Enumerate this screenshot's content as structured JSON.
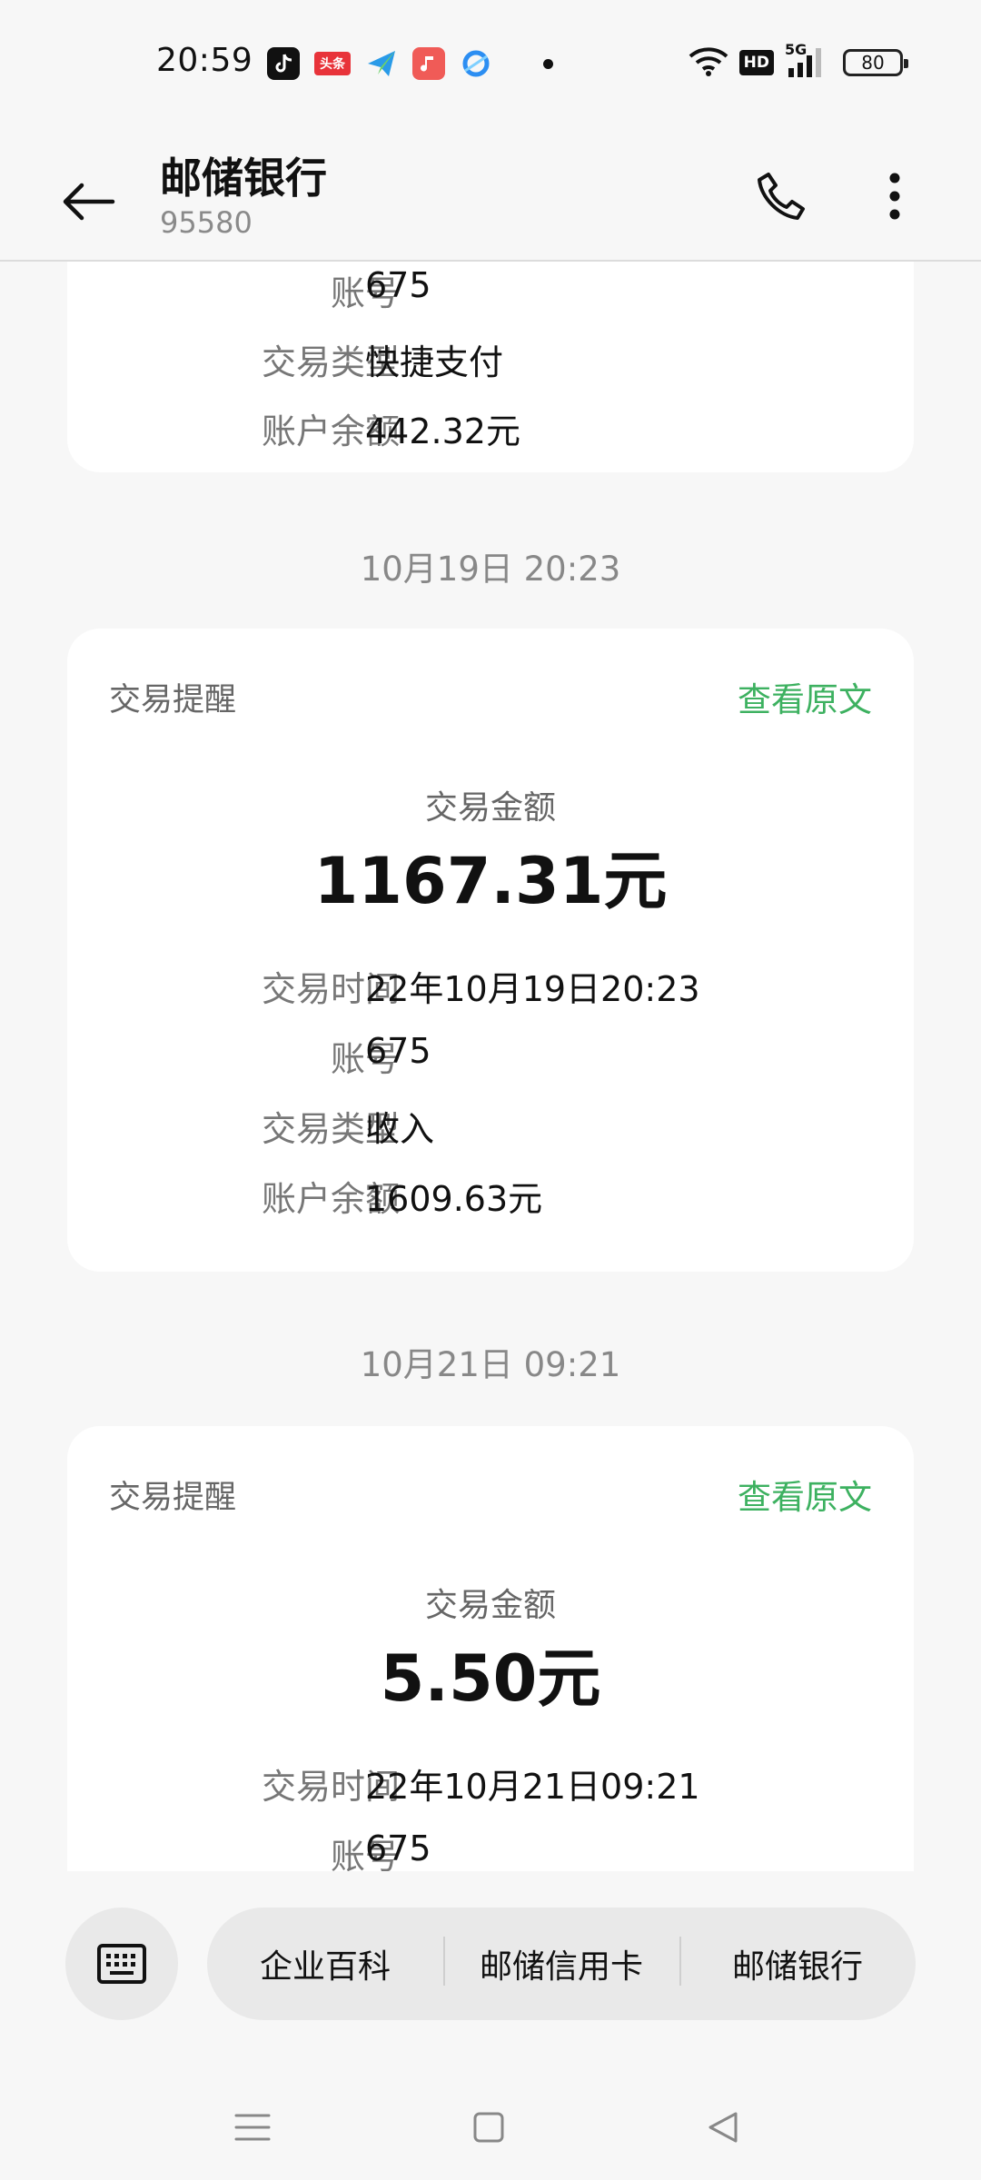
{
  "status_bar": {
    "time": "20:59",
    "app_icons": [
      "tiktok-icon",
      "toutiao-icon",
      "paper-plane-icon",
      "music-icon",
      "browser-icon"
    ],
    "toutiao_label": "头条",
    "hd_label": "HD",
    "signal_label": "5G",
    "battery": "80"
  },
  "header": {
    "title": "邮储银行",
    "subtitle": "95580"
  },
  "partial_card": {
    "rows": [
      {
        "label": "账号",
        "value": "675"
      },
      {
        "label": "交易类型",
        "value": "快捷支付"
      },
      {
        "label": "账户余额",
        "value": "442.32元"
      }
    ]
  },
  "messages": [
    {
      "timestamp": "10月19日 20:23",
      "head": "交易提醒",
      "view_original": "查看原文",
      "amount_label": "交易金额",
      "amount": "1167.31元",
      "rows": [
        {
          "label": "交易时间",
          "value": "22年10月19日20:23"
        },
        {
          "label": "账号",
          "value": "675"
        },
        {
          "label": "交易类型",
          "value": "收入"
        },
        {
          "label": "账户余额",
          "value": "1609.63元"
        }
      ]
    },
    {
      "timestamp": "10月21日 09:21",
      "head": "交易提醒",
      "view_original": "查看原文",
      "amount_label": "交易金额",
      "amount": "5.50元",
      "rows": [
        {
          "label": "交易时间",
          "value": "22年10月21日09:21"
        },
        {
          "label": "账号",
          "value": "675"
        }
      ]
    }
  ],
  "bottom_menu": {
    "keyboard_icon": "keyboard-icon",
    "items": [
      "企业百科",
      "邮储信用卡",
      "邮储银行"
    ]
  },
  "nav_bar": {
    "icons": [
      "menu-icon",
      "home-icon",
      "back-triangle-icon"
    ]
  },
  "colors": {
    "accent_green": "#3db160",
    "background": "#f7f7f7",
    "card": "#ffffff"
  }
}
